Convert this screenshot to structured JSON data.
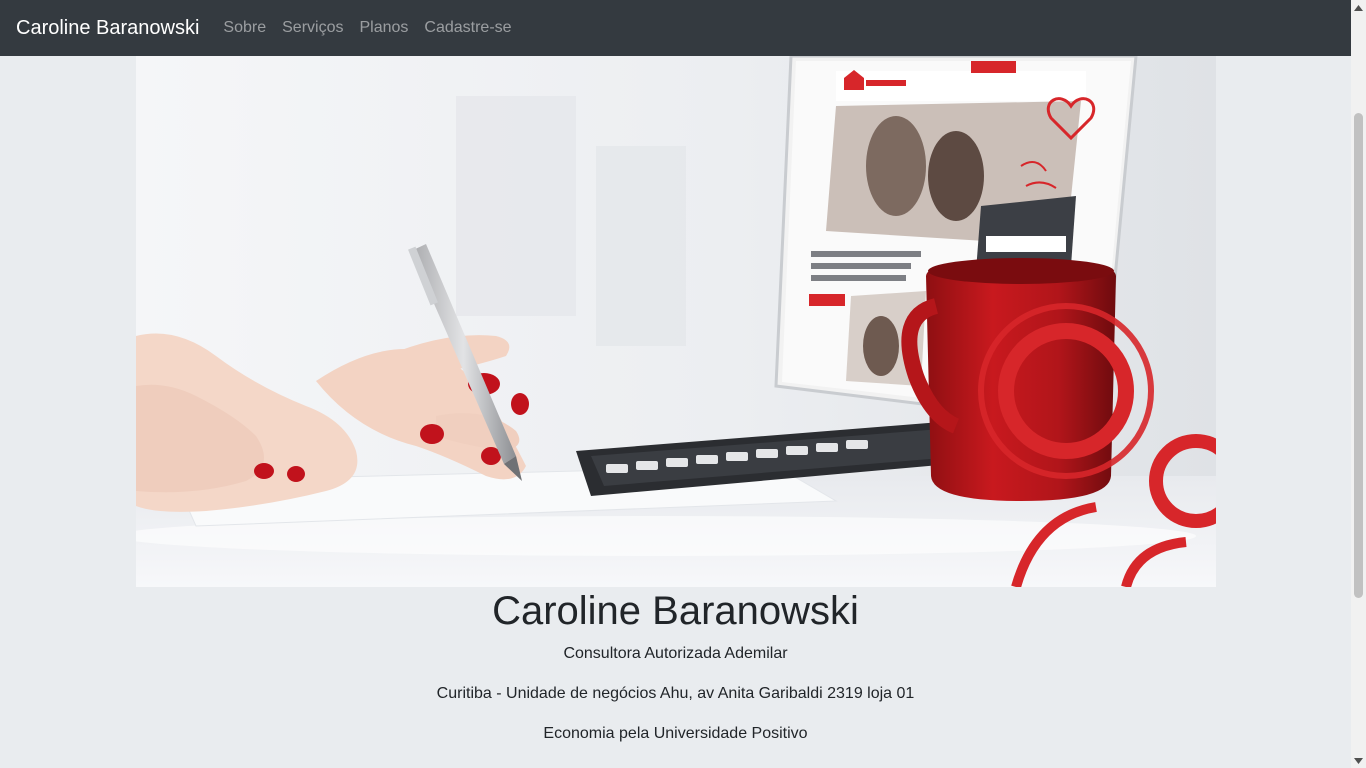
{
  "navbar": {
    "brand": "Caroline Baranowski",
    "links": [
      "Sobre",
      "Serviços",
      "Planos",
      "Cadastre-se"
    ]
  },
  "profile": {
    "name": "Caroline Baranowski",
    "role": "Consultora Autorizada Ademilar",
    "location": "Curitiba - Unidade de negócios Ahu, av Anita Garibaldi 2319 loja 01",
    "education": "Economia pela Universidade Positivo"
  },
  "colors": {
    "navbar_bg": "#343a40",
    "page_bg": "#e9ecef",
    "brand_red": "#d7262a"
  }
}
